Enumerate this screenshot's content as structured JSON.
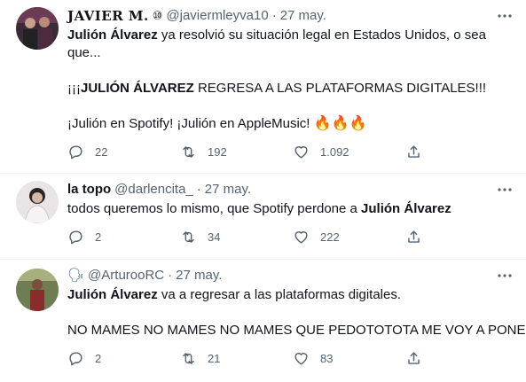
{
  "tweets": [
    {
      "name": "JAVIER M.",
      "badge": "⑩",
      "handle": "@javiermleyva10",
      "date": "27 may.",
      "lines": [
        [
          {
            "b": "Julión Álvarez"
          },
          {
            "t": " ya resolvió su situación legal en Estados Unidos, o sea"
          }
        ],
        [
          {
            "t": "que..."
          }
        ],
        [],
        [
          {
            "t": "¡¡¡"
          },
          {
            "b": "JULIÓN ÁLVAREZ"
          },
          {
            "t": " REGRESA A LAS PLATAFORMAS DIGITALES!!!"
          }
        ],
        [],
        [
          {
            "t": "¡Julión en Spotify! ¡Julión en AppleMusic! "
          },
          {
            "e": "🔥🔥🔥"
          }
        ]
      ],
      "replies": "22",
      "retweets": "192",
      "likes": "1.092"
    },
    {
      "name": "la topo",
      "badge": "",
      "handle": "@darlencita_",
      "date": "27 may.",
      "lines": [
        [
          {
            "t": "todos queremos lo mismo, que Spotify perdone a "
          },
          {
            "b": "Julión Álvarez"
          }
        ]
      ],
      "replies": "2",
      "retweets": "34",
      "likes": "222"
    },
    {
      "name": "🗣",
      "badge": "",
      "handle": "@ArturooRC",
      "date": "27 may.",
      "lines": [
        [
          {
            "b": "Julión Álvarez"
          },
          {
            "t": " va a regresar a las plataformas digitales."
          }
        ],
        [],
        [
          {
            "t": "NO MAMES NO MAMES NO MAMES QUE PEDOTOTOTA ME VOY A PONER"
          }
        ]
      ],
      "replies": "2",
      "retweets": "21",
      "likes": "83"
    }
  ],
  "icons": {
    "reply": "reply-icon",
    "retweet": "retweet-icon",
    "like": "heart-icon",
    "share": "share-icon",
    "more": "more-icon"
  },
  "colors": {
    "text": "#0f1419",
    "secondary": "#536471",
    "divider": "#eff3f4"
  }
}
